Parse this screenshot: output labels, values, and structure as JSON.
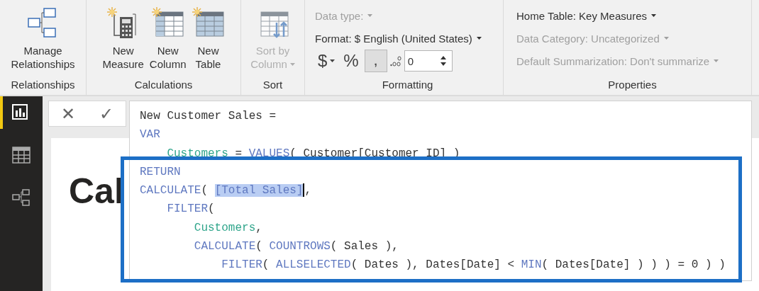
{
  "ribbon": {
    "groups": [
      {
        "kind": "buttons",
        "label": "Relationships",
        "buttons": [
          {
            "lines": [
              "Manage",
              "Relationships"
            ],
            "disabled": false,
            "dropdown": false
          }
        ]
      },
      {
        "kind": "buttons",
        "label": "Calculations",
        "buttons": [
          {
            "lines": [
              "New",
              "Measure"
            ],
            "disabled": false,
            "dropdown": false
          },
          {
            "lines": [
              "New",
              "Column"
            ],
            "disabled": false,
            "dropdown": false
          },
          {
            "lines": [
              "New",
              "Table"
            ],
            "disabled": false,
            "dropdown": false
          }
        ]
      },
      {
        "kind": "buttons",
        "label": "Sort",
        "buttons": [
          {
            "lines": [
              "Sort by",
              "Column"
            ],
            "disabled": true,
            "dropdown": true
          }
        ]
      },
      {
        "kind": "formatting",
        "label": "Formatting",
        "data_type": {
          "label": "Data type:",
          "disabled": true
        },
        "format": {
          "label": "Format: $ English (United States)",
          "disabled": false
        },
        "currency": "$",
        "percent": "%",
        "comma": {
          "label": ",",
          "selected": true
        },
        "decimals": "0"
      },
      {
        "kind": "properties",
        "label": "Properties",
        "items": [
          {
            "label": "Home Table: Key Measures",
            "disabled": false
          },
          {
            "label": "Data Category: Uncategorized",
            "disabled": true
          },
          {
            "label": "Default Summarization: Don't summarize",
            "disabled": true
          }
        ]
      }
    ]
  },
  "nav": [
    {
      "selected": true
    },
    {
      "selected": false
    },
    {
      "selected": false
    }
  ],
  "formula_bar": {
    "cancel": "✕",
    "commit": "✓",
    "lines": [
      [
        {
          "kind": "text",
          "text": "New Customer Sales ="
        }
      ],
      [
        {
          "kind": "keyword",
          "text": "VAR"
        }
      ],
      [
        {
          "kind": "variable",
          "text": "    Customers"
        },
        {
          "kind": "text",
          "text": " = "
        },
        {
          "kind": "keyword",
          "text": "VALUES"
        },
        {
          "kind": "text",
          "text": "( Customer[Customer ID] )"
        }
      ],
      [
        {
          "kind": "keyword",
          "text": "RETURN"
        }
      ],
      [
        {
          "kind": "keyword",
          "text": "CALCULATE"
        },
        {
          "kind": "text",
          "text": "( "
        },
        {
          "kind": "selection",
          "text": "[Total Sales]"
        },
        {
          "kind": "caret"
        },
        {
          "kind": "text",
          "text": ","
        }
      ],
      [
        {
          "kind": "keyword",
          "text": "    FILTER"
        },
        {
          "kind": "text",
          "text": "("
        }
      ],
      [
        {
          "kind": "variable",
          "text": "        Customers"
        },
        {
          "kind": "text",
          "text": ","
        }
      ],
      [
        {
          "kind": "keyword",
          "text": "        CALCULATE"
        },
        {
          "kind": "text",
          "text": "( "
        },
        {
          "kind": "keyword",
          "text": "COUNTROWS"
        },
        {
          "kind": "text",
          "text": "( Sales ),"
        }
      ],
      [
        {
          "kind": "keyword",
          "text": "            FILTER"
        },
        {
          "kind": "text",
          "text": "( "
        },
        {
          "kind": "keyword",
          "text": "ALLSELECTED"
        },
        {
          "kind": "text",
          "text": "( Dates ), Dates[Date] < "
        },
        {
          "kind": "keyword",
          "text": "MIN"
        },
        {
          "kind": "text",
          "text": "( Dates[Date] ) ) ) = 0 ) )"
        }
      ]
    ]
  },
  "canvas": {
    "heading": "Cal"
  }
}
